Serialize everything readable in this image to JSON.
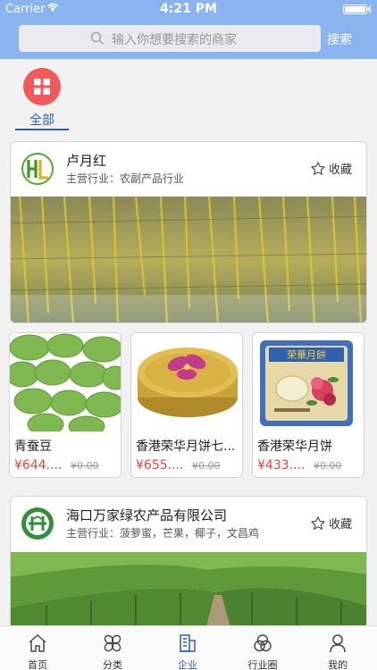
{
  "status_bar": {
    "carrier": "Carrier",
    "time": "4:21 PM"
  },
  "search": {
    "placeholder": "输入你想要搜索的商家",
    "button_label": "搜索"
  },
  "category_tabs": [
    {
      "label": "全部",
      "selected": true
    }
  ],
  "merchants": [
    {
      "name": "卢月红",
      "industry": "主营行业：农副产品行业",
      "favorite_label": "收藏",
      "products": [
        {
          "name": "青蚕豆",
          "price": "¥644....",
          "old_price": "¥0.00"
        },
        {
          "name": "香港荣华月饼七...",
          "price": "¥655....",
          "old_price": "¥0.00"
        },
        {
          "name": "香港荣华月饼",
          "price": "¥433....",
          "old_price": "¥0.00"
        }
      ]
    },
    {
      "name": "海口万家绿农产品有限公司",
      "industry": "主营行业：菠萝蜜，芒果，椰子，文昌鸡",
      "favorite_label": "收藏"
    }
  ],
  "bottom_nav": [
    {
      "label": "首页",
      "icon": "home-icon"
    },
    {
      "label": "分类",
      "icon": "category-icon"
    },
    {
      "label": "企业",
      "icon": "enterprise-icon",
      "active": true
    },
    {
      "label": "行业圈",
      "icon": "circles-icon"
    },
    {
      "label": "我的",
      "icon": "person-icon"
    }
  ],
  "colors": {
    "header": "#8ab4f0",
    "accent": "#2e5cb8",
    "price": "#f04040",
    "category_circle": "#f05a5a"
  }
}
